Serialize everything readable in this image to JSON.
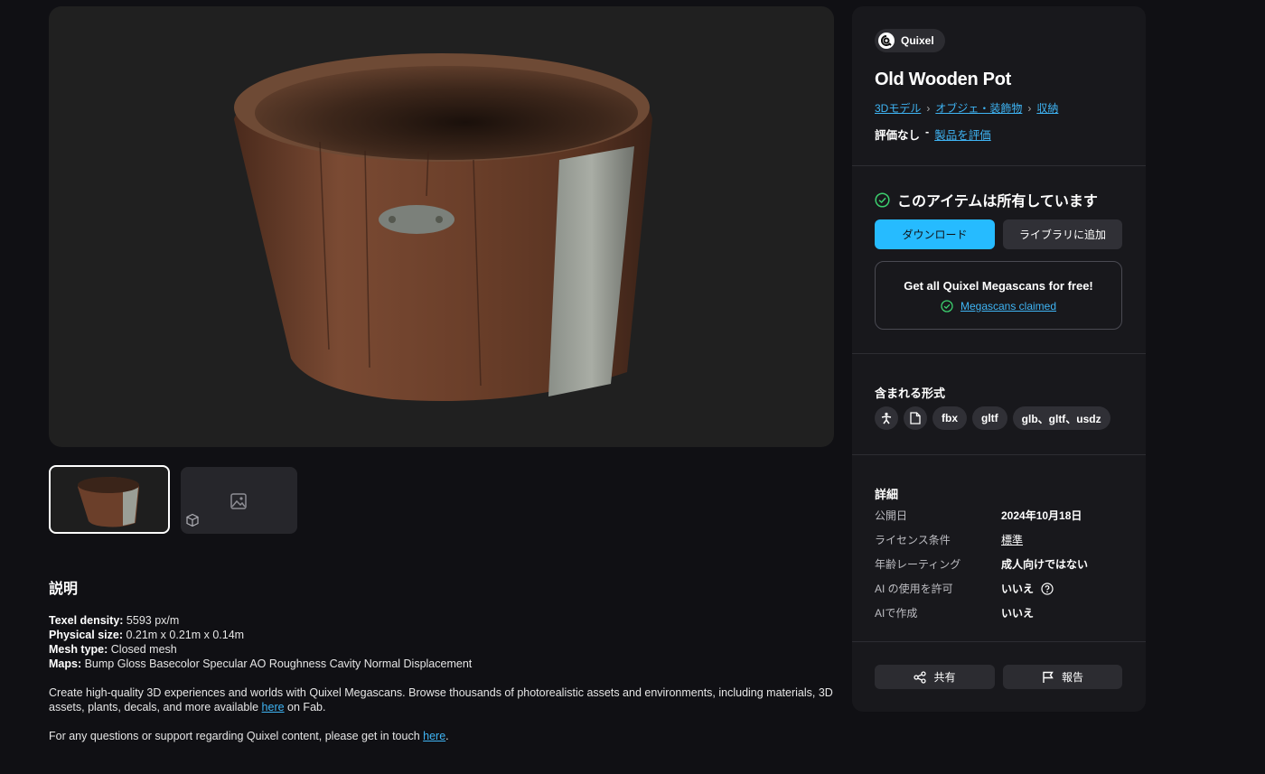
{
  "gallery": {
    "thumbnails": [
      "pot-photo",
      "image-placeholder"
    ]
  },
  "description": {
    "heading": "説明",
    "specs": [
      {
        "label": "Texel density:",
        "value": " 5593 px/m"
      },
      {
        "label": "Physical size:",
        "value": " 0.21m x 0.21m x 0.14m"
      },
      {
        "label": "Mesh type:",
        "value": " Closed mesh"
      },
      {
        "label": "Maps:",
        "value": " Bump Gloss Basecolor Specular AO Roughness Cavity Normal Displacement"
      }
    ],
    "para1_before": "Create high-quality 3D experiences and worlds with Quixel Megascans. Browse thousands of photorealistic assets and environments, including materials, 3D assets, plants, decals, and more available ",
    "para1_link": "here",
    "para1_after": " on Fab.",
    "para2_before": "For any questions or support regarding Quixel content, please get in touch ",
    "para2_link": "here",
    "para2_after": "."
  },
  "product": {
    "publisher": "Quixel",
    "title": "Old Wooden Pot",
    "breadcrumbs": [
      "3Dモデル",
      "オブジェ・装飾物",
      "収納"
    ],
    "rating_text": "評価なし",
    "rating_sep": "-",
    "rate_link": "製品を評価"
  },
  "ownership": {
    "status": "このアイテムは所有しています",
    "download_label": "ダウンロード",
    "library_label": "ライブラリに追加",
    "promo_heading": "Get all Quixel Megascans for free!",
    "promo_link": "Megascans claimed"
  },
  "formats": {
    "heading": "含まれる形式",
    "items": [
      "fbx",
      "gltf",
      "glb、gltf、usdz"
    ],
    "icons": [
      "unreal-engine-icon",
      "file-icon"
    ]
  },
  "details": {
    "heading": "詳細",
    "rows": [
      {
        "key": "公開日",
        "value": "2024年10月18日"
      },
      {
        "key": "ライセンス条件",
        "value": "標準"
      },
      {
        "key": "年齢レーティング",
        "value": "成人向けではない"
      },
      {
        "key": "AI の使用を許可",
        "value": "いいえ"
      },
      {
        "key": "AIで作成",
        "value": "いいえ"
      }
    ]
  },
  "actions": {
    "share_label": "共有",
    "report_label": "報告"
  },
  "colors": {
    "accent": "#26bbff",
    "link": "#3fb5f5",
    "success": "#3ccf6e",
    "background": "#101014",
    "panel": "#18181c"
  }
}
